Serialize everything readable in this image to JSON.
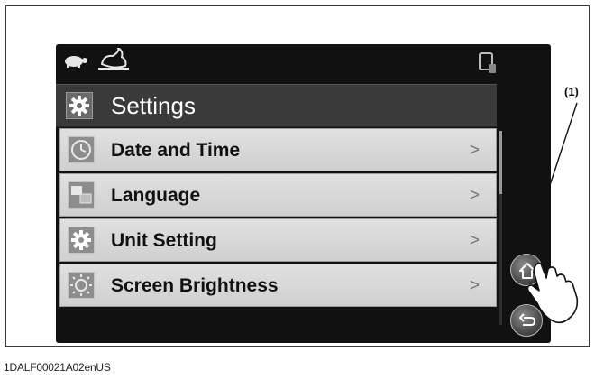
{
  "status_bar": {
    "icons": [
      "turtle-icon",
      "rabbit-icon",
      "device-status-icon"
    ]
  },
  "header": {
    "title": "Settings",
    "icon": "gear-icon"
  },
  "menu": {
    "items": [
      {
        "label": "Date and Time",
        "icon": "clock-icon",
        "arrow": ">"
      },
      {
        "label": "Language",
        "icon": "language-icon",
        "arrow": ">"
      },
      {
        "label": "Unit Setting",
        "icon": "gear-icon",
        "arrow": ">"
      },
      {
        "label": "Screen Brightness",
        "icon": "brightness-icon",
        "arrow": ">"
      }
    ]
  },
  "side_buttons": {
    "home_icon": "home-icon",
    "back_icon": "back-arrow-icon"
  },
  "annotations": {
    "callout": "(1)",
    "pointer_icon": "pointing-hand-icon"
  },
  "figure": {
    "code": "1DALF00021A02enUS"
  },
  "colors": {
    "device_bg": "#111111",
    "title_bar": "#3a3a3a",
    "menu_item": "#d8d8d8"
  }
}
